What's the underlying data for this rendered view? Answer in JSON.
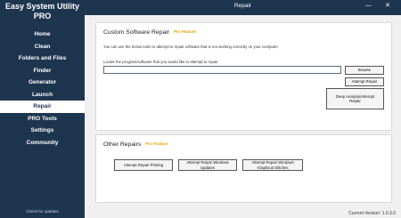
{
  "app": {
    "name": "Easy System Utility PRO",
    "window_title": "Repair",
    "minimize_glyph": "—",
    "close_glyph": "✕"
  },
  "sidebar": {
    "items": [
      {
        "label": "Home"
      },
      {
        "label": "Clean"
      },
      {
        "label": "Folders and Files"
      },
      {
        "label": "Finder"
      },
      {
        "label": "Generator"
      },
      {
        "label": "Launch"
      },
      {
        "label": "Repair",
        "active": true
      },
      {
        "label": "PRO Tools"
      },
      {
        "label": "Settings"
      },
      {
        "label": "Community"
      }
    ],
    "check_updates": "Check for updates"
  },
  "custom_repair": {
    "title": "Custom Software Repair",
    "badge": "Pro Feature",
    "description": "You can use the below tools to attempt to repair software that is not working correctly on your computer.",
    "locate_label": "Locate the program/software that you would like to attempt to repair.",
    "path_value": "",
    "browse_label": "Browse",
    "attempt_label": "Attempt Repair",
    "deep_label": "Deep Analysis/Attempt Repair"
  },
  "other_repairs": {
    "title": "Other Repairs",
    "badge": "Pro Feature",
    "printing_label": "Attempt Repair Printing",
    "updates_label": "Attempt Repair Windows Updates",
    "glitches_label": "Attempt Repair Windows Graphical Glitches"
  },
  "footer": {
    "version": "Current Version: 1.0.3.0"
  },
  "colors": {
    "sidebar_bg": "#1e3550",
    "badge": "#e5a000",
    "content_bg": "#f0f0f0"
  }
}
